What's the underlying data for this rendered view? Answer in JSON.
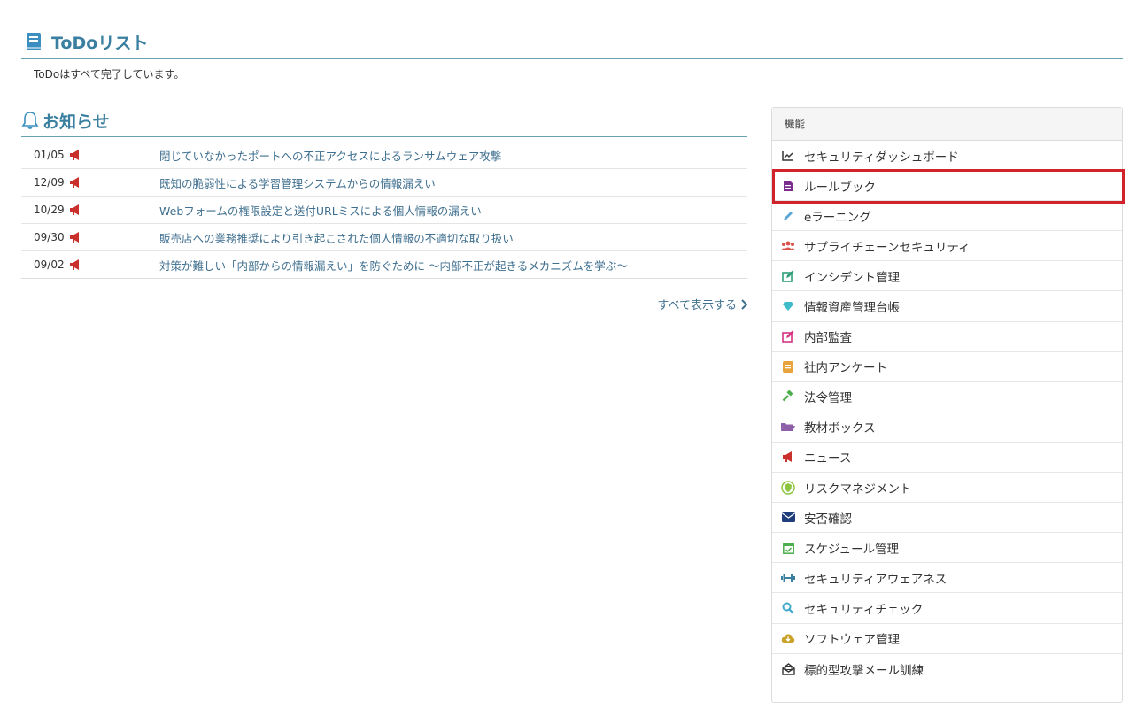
{
  "todo": {
    "title": "ToDoリスト",
    "status": "ToDoはすべて完了しています。"
  },
  "news": {
    "title": "お知らせ",
    "items": [
      {
        "date": "01/05",
        "text": "閉じていなかったポートへの不正アクセスによるランサムウェア攻撃"
      },
      {
        "date": "12/09",
        "text": "既知の脆弱性による学習管理システムからの情報漏えい"
      },
      {
        "date": "10/29",
        "text": "Webフォームの権限設定と送付URLミスによる個人情報の漏えい"
      },
      {
        "date": "09/30",
        "text": "販売店への業務推奨により引き起こされた個人情報の不適切な取り扱い"
      },
      {
        "date": "09/02",
        "text": "対策が難しい「内部からの情報漏えい」を防ぐために ～内部不正が起きるメカニズムを学ぶ～"
      }
    ],
    "show_all": "すべて表示する"
  },
  "features": {
    "heading": "機能",
    "items": [
      {
        "label": "セキュリティダッシュボード",
        "icon": "chart-line-icon",
        "color": "#333333"
      },
      {
        "label": "ルールブック",
        "icon": "document-icon",
        "color": "#7b2d8e"
      },
      {
        "label": "eラーニング",
        "icon": "pencil-icon",
        "color": "#5aa6d6"
      },
      {
        "label": "サプライチェーンセキュリティ",
        "icon": "users-icon",
        "color": "#d9534f"
      },
      {
        "label": "インシデント管理",
        "icon": "edit-icon",
        "color": "#2e9e7a"
      },
      {
        "label": "情報資産管理台帳",
        "icon": "diamond-icon",
        "color": "#3fbcc9"
      },
      {
        "label": "内部監査",
        "icon": "edit-pink-icon",
        "color": "#d63384"
      },
      {
        "label": "社内アンケート",
        "icon": "survey-icon",
        "color": "#e8a33a"
      },
      {
        "label": "法令管理",
        "icon": "gavel-icon",
        "color": "#4cae4c"
      },
      {
        "label": "教材ボックス",
        "icon": "folder-icon",
        "color": "#8e5fa8"
      },
      {
        "label": "ニュース",
        "icon": "megaphone-icon",
        "color": "#c9302c"
      },
      {
        "label": "リスクマネジメント",
        "icon": "shield-icon",
        "color": "#8cc63f"
      },
      {
        "label": "安否確認",
        "icon": "envelope-icon",
        "color": "#1f3d7a"
      },
      {
        "label": "スケジュール管理",
        "icon": "calendar-check-icon",
        "color": "#4cae4c"
      },
      {
        "label": "セキュリティアウェアネス",
        "icon": "dumbbell-icon",
        "color": "#3a7fa0"
      },
      {
        "label": "セキュリティチェック",
        "icon": "search-icon",
        "color": "#3fa9c9"
      },
      {
        "label": "ソフトウェア管理",
        "icon": "cloud-download-icon",
        "color": "#c9a227"
      },
      {
        "label": "標的型攻撃メール訓練",
        "icon": "mail-open-icon",
        "color": "#333333"
      }
    ]
  },
  "colors": {
    "heading": "#3a7fa0",
    "link": "#3f6f8f",
    "highlight": "#d0232a",
    "megaphone": "#c9302c"
  }
}
